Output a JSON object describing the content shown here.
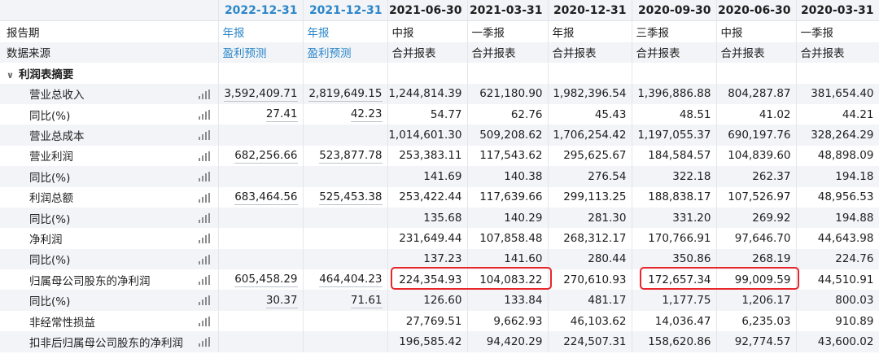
{
  "header": {
    "label": "",
    "dates": [
      "2022-12-31",
      "2021-12-31",
      "2021-06-30",
      "2021-03-31",
      "2020-12-31",
      "2020-09-30",
      "2020-06-30",
      "2020-03-31"
    ]
  },
  "meta_rows": [
    {
      "label": "报告期",
      "values": [
        "年报",
        "年报",
        "中报",
        "一季报",
        "年报",
        "三季报",
        "中报",
        "一季报"
      ]
    },
    {
      "label": "数据来源",
      "values": [
        "盈利预测",
        "盈利预测",
        "合并报表",
        "合并报表",
        "合并报表",
        "合并报表",
        "合并报表",
        "合并报表"
      ]
    }
  ],
  "section": {
    "caret": "∨",
    "label": "利润表摘要"
  },
  "rows": [
    {
      "label": "营业总收入",
      "values": [
        "3,592,409.71",
        "2,819,649.15",
        "1,244,814.39",
        "621,180.90",
        "1,982,396.54",
        "1,396,886.88",
        "804,287.87",
        "381,654.40"
      ]
    },
    {
      "label": "同比(%)",
      "values": [
        "27.41",
        "42.23",
        "54.77",
        "62.76",
        "45.43",
        "48.51",
        "41.02",
        "44.21"
      ]
    },
    {
      "label": "营业总成本",
      "values": [
        "",
        "",
        "1,014,601.30",
        "509,208.62",
        "1,706,254.42",
        "1,197,055.37",
        "690,197.76",
        "328,264.29"
      ]
    },
    {
      "label": "营业利润",
      "values": [
        "682,256.66",
        "523,877.78",
        "253,383.11",
        "117,543.62",
        "295,625.67",
        "184,584.57",
        "104,839.60",
        "48,898.09"
      ]
    },
    {
      "label": "同比(%)",
      "values": [
        "",
        "",
        "141.69",
        "140.38",
        "276.54",
        "322.18",
        "262.37",
        "194.18"
      ]
    },
    {
      "label": "利润总额",
      "values": [
        "683,464.56",
        "525,453.38",
        "253,422.44",
        "117,639.66",
        "299,113.25",
        "188,838.17",
        "107,526.97",
        "48,956.53"
      ]
    },
    {
      "label": "同比(%)",
      "values": [
        "",
        "",
        "135.68",
        "140.29",
        "281.30",
        "331.20",
        "269.92",
        "194.88"
      ]
    },
    {
      "label": "净利润",
      "values": [
        "",
        "",
        "231,649.44",
        "107,858.48",
        "268,312.17",
        "170,766.91",
        "97,646.70",
        "44,643.98"
      ]
    },
    {
      "label": "同比(%)",
      "values": [
        "",
        "",
        "137.23",
        "141.60",
        "280.44",
        "350.86",
        "268.19",
        "224.76"
      ]
    },
    {
      "label": "归属母公司股东的净利润",
      "values": [
        "605,458.29",
        "464,404.23",
        "224,354.93",
        "104,083.22",
        "270,610.93",
        "172,657.34",
        "99,009.59",
        "44,510.91"
      ]
    },
    {
      "label": "同比(%)",
      "values": [
        "30.37",
        "71.61",
        "126.60",
        "133.84",
        "481.17",
        "1,177.75",
        "1,206.17",
        "800.03"
      ]
    },
    {
      "label": "非经常性损益",
      "values": [
        "",
        "",
        "27,769.51",
        "9,662.93",
        "46,103.62",
        "14,036.47",
        "6,235.03",
        "910.89"
      ]
    },
    {
      "label": "扣非后归属母公司股东的净利润",
      "values": [
        "",
        "",
        "196,585.42",
        "94,420.29",
        "224,507.31",
        "158,620.86",
        "92,774.57",
        "43,600.02"
      ]
    }
  ],
  "colors": {
    "accent_blue": "#2b86c9",
    "highlight_red": "#e8262b",
    "stripe": "#f2f4f7"
  },
  "icons": {
    "row_chart": "bar-chart-icon",
    "section_toggle": "chevron-down-icon"
  }
}
